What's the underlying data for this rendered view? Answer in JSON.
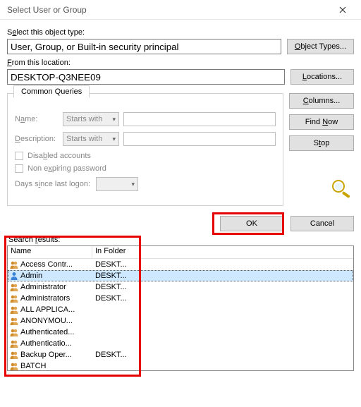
{
  "window": {
    "title": "Select User or Group"
  },
  "objectType": {
    "label_before": "S",
    "label_underline": "e",
    "label_after": "lect this object type:",
    "value": "User, Group, or Built-in security principal",
    "button": "Object Types..."
  },
  "location": {
    "label_before": "",
    "label_underline": "F",
    "label_after": "rom this location:",
    "value": "DESKTOP-Q3NEE09",
    "button": "Locations..."
  },
  "commonQueries": {
    "tab": "Common Queries",
    "nameLabel": "Name:",
    "descLabel": "Description:",
    "startsWith": "Starts with",
    "disabled": "Disabled accounts",
    "nonExpiring": "Non expiring password",
    "daysLabel_before": "Days s",
    "daysLabel_underline": "i",
    "daysLabel_after": "nce last logon:"
  },
  "sideButtons": {
    "columns": "Columns...",
    "findNow": "Find Now",
    "stop": "Stop"
  },
  "actions": {
    "ok": "OK",
    "cancel": "Cancel"
  },
  "results": {
    "label_before": "Search ",
    "label_underline": "r",
    "label_after": "esults:",
    "colName": "Name",
    "colFolder": "In Folder",
    "rows": [
      {
        "icon": "group",
        "name": "Access Contr...",
        "folder": "DESKT...",
        "selected": false
      },
      {
        "icon": "user",
        "name": "Admin",
        "folder": "DESKT...",
        "selected": true
      },
      {
        "icon": "group",
        "name": "Administrator",
        "folder": "DESKT...",
        "selected": false
      },
      {
        "icon": "group",
        "name": "Administrators",
        "folder": "DESKT...",
        "selected": false
      },
      {
        "icon": "group",
        "name": "ALL APPLICA...",
        "folder": "",
        "selected": false
      },
      {
        "icon": "group",
        "name": "ANONYMOU...",
        "folder": "",
        "selected": false
      },
      {
        "icon": "group",
        "name": "Authenticated...",
        "folder": "",
        "selected": false
      },
      {
        "icon": "group",
        "name": "Authenticatio...",
        "folder": "",
        "selected": false
      },
      {
        "icon": "group",
        "name": "Backup Oper...",
        "folder": "DESKT...",
        "selected": false
      },
      {
        "icon": "group",
        "name": "BATCH",
        "folder": "",
        "selected": false
      }
    ]
  }
}
